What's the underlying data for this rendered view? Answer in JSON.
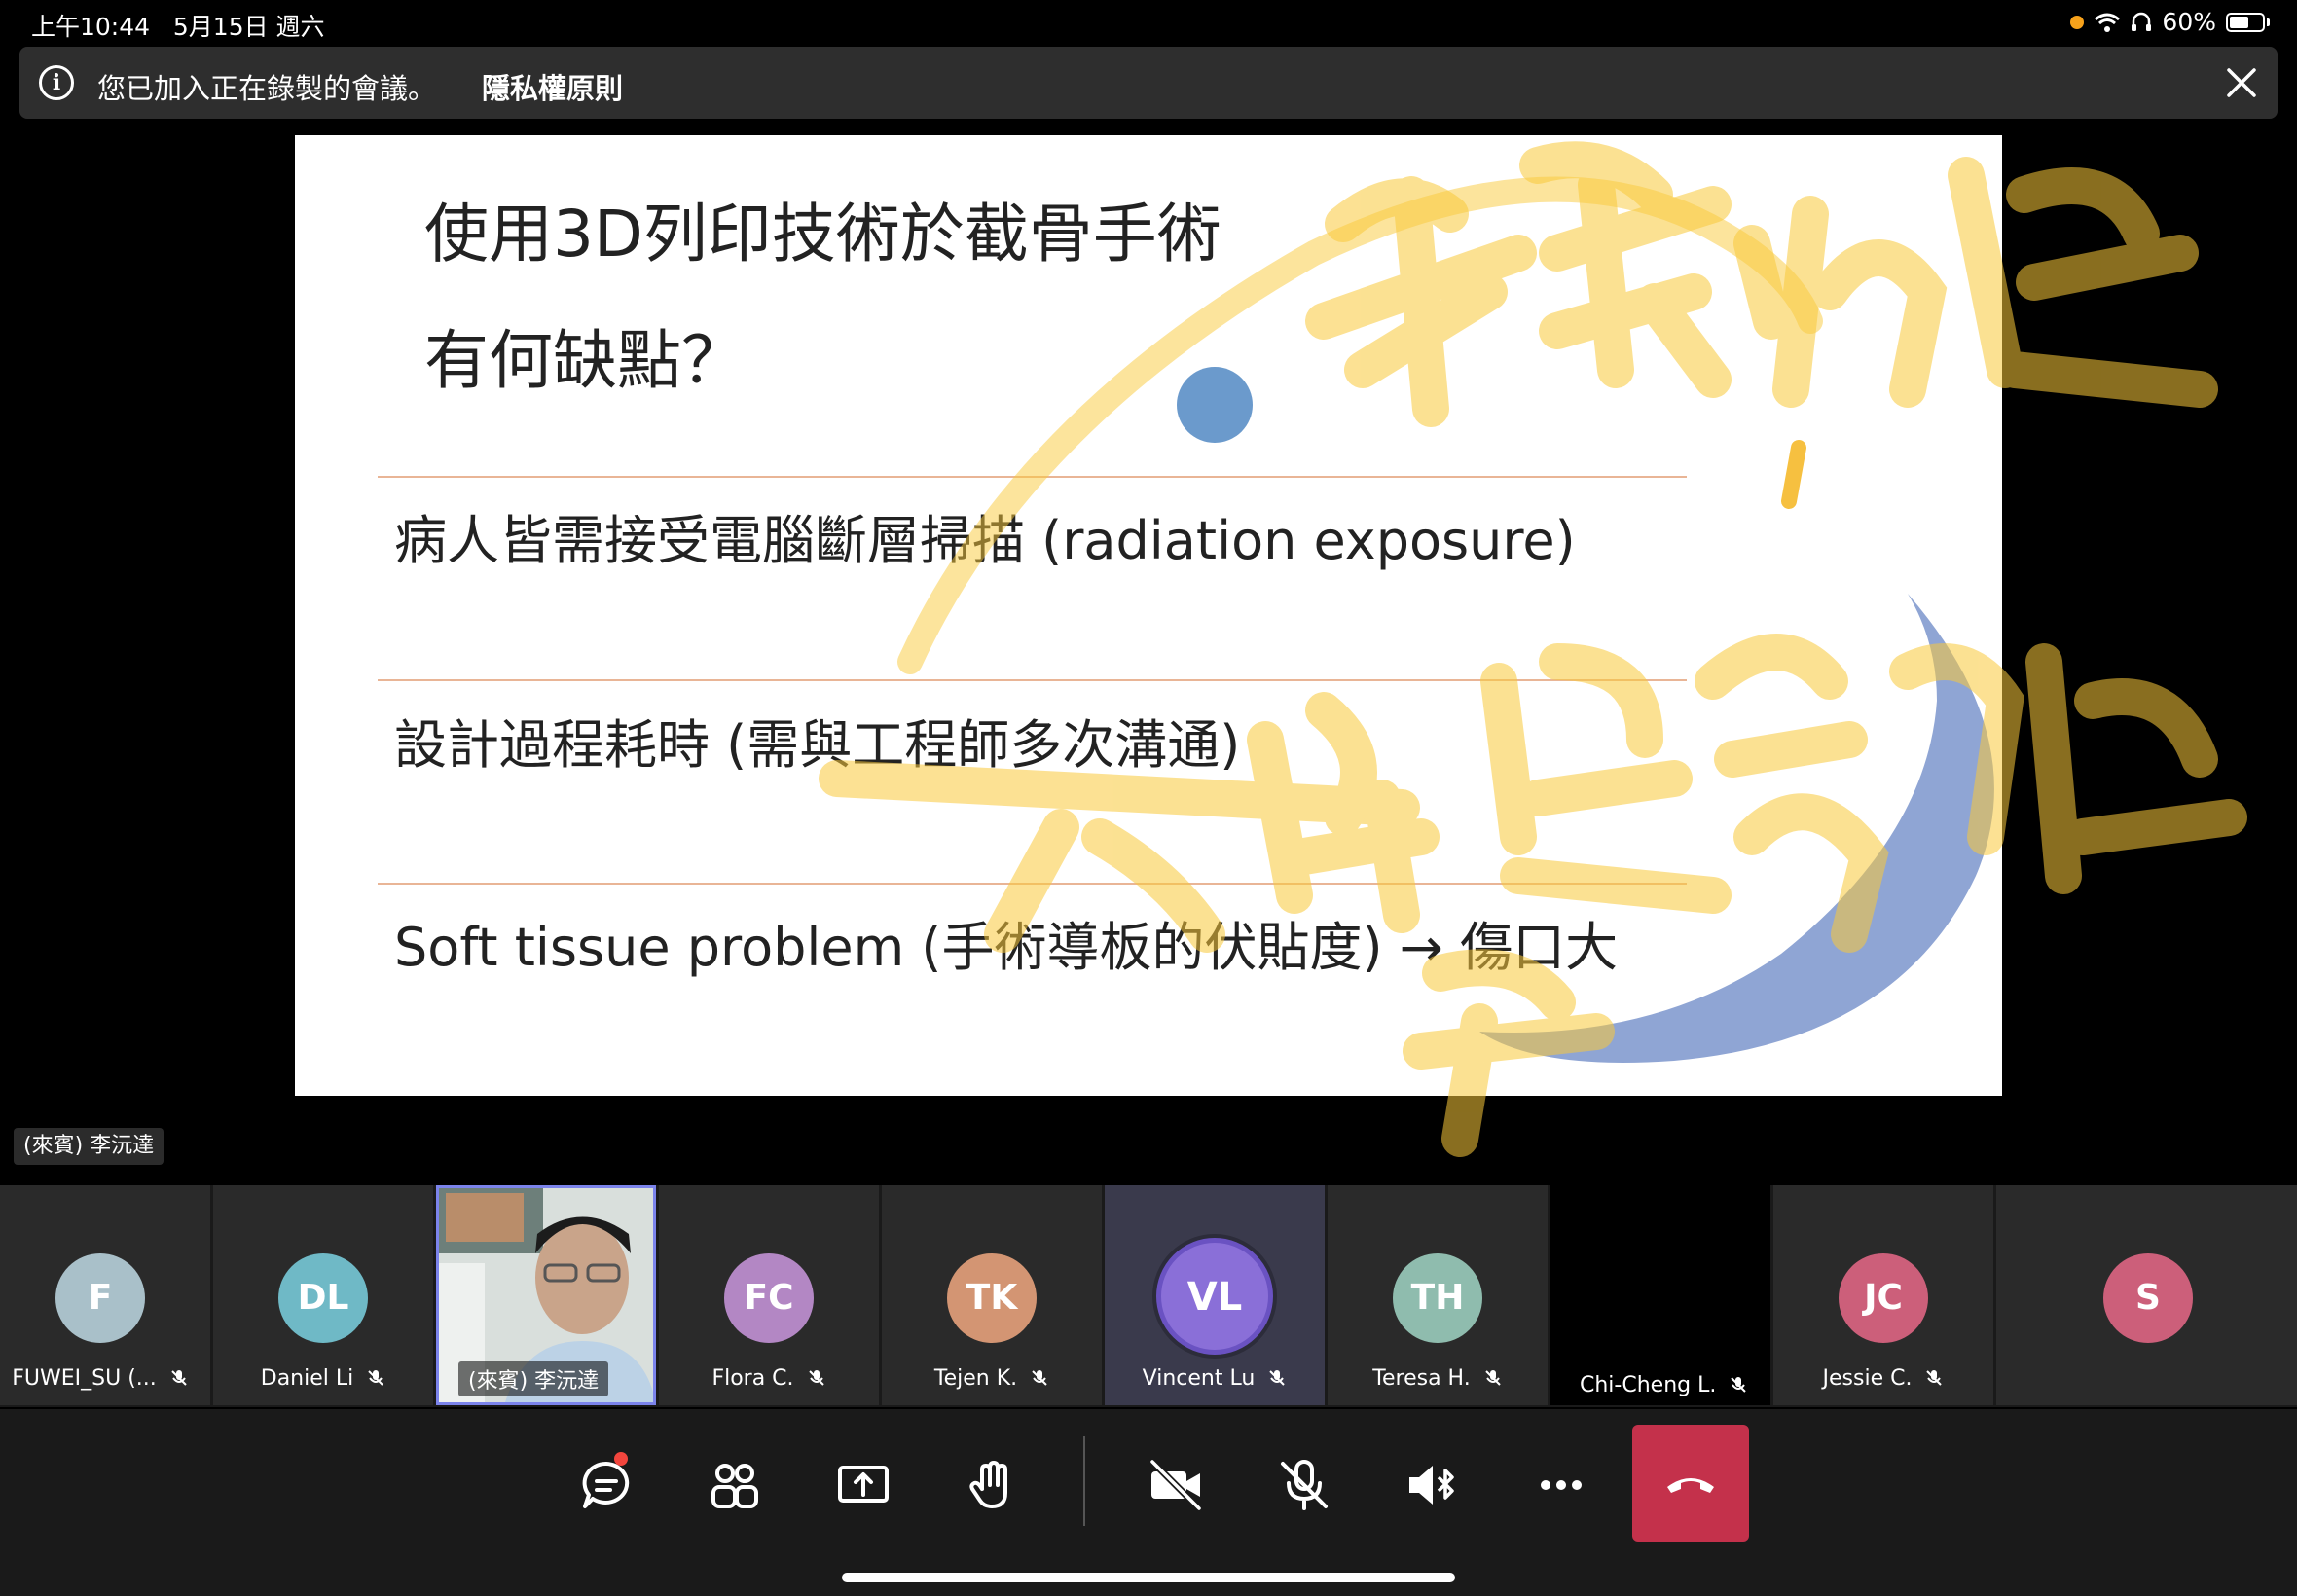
{
  "status_bar": {
    "time": "上午10:44",
    "date": "5月15日 週六",
    "battery": "60%",
    "battery_level": 0.6
  },
  "banner": {
    "message": "您已加入正在錄製的會議。",
    "link": "隱私權原則"
  },
  "slide": {
    "title_line1": "使用3D列印技術於截骨手術",
    "title_line2": "有何缺點？",
    "bullets": [
      "病人皆需接受電腦斷層掃描 (radiation exposure)",
      "設計過程耗時 (需與工程師多次溝通)",
      "Soft tissue problem (手術導板的伏貼度) → 傷口大"
    ]
  },
  "presenter_label": "(來賓) 李沅達",
  "participants": [
    {
      "initials": "F",
      "name": "FUWEI_SU (...",
      "color": "#a9c0c9"
    },
    {
      "initials": "DL",
      "name": "Daniel Li",
      "color": "#6fb9c6"
    },
    {
      "initials": "",
      "name": "(來賓) 李沅達",
      "color": "#7b83eb"
    },
    {
      "initials": "FC",
      "name": "Flora C.",
      "color": "#b387c4"
    },
    {
      "initials": "TK",
      "name": "Tejen K.",
      "color": "#d39573"
    },
    {
      "initials": "VL",
      "name": "Vincent Lu",
      "color": "#8a6fd8"
    },
    {
      "initials": "TH",
      "name": "Teresa H.",
      "color": "#8fbcae"
    },
    {
      "initials": "",
      "name": "Chi-Cheng L.",
      "color": "#000000"
    },
    {
      "initials": "JC",
      "name": "Jessie C.",
      "color": "#cc5f7a"
    },
    {
      "initials": "S",
      "name": "",
      "color": "#cc5f7a"
    }
  ],
  "colors": {
    "hangup": "#c4314b",
    "accent": "#7b83eb",
    "ink_yellow": "#f9c93a",
    "ink_blue": "#7b95cc"
  }
}
